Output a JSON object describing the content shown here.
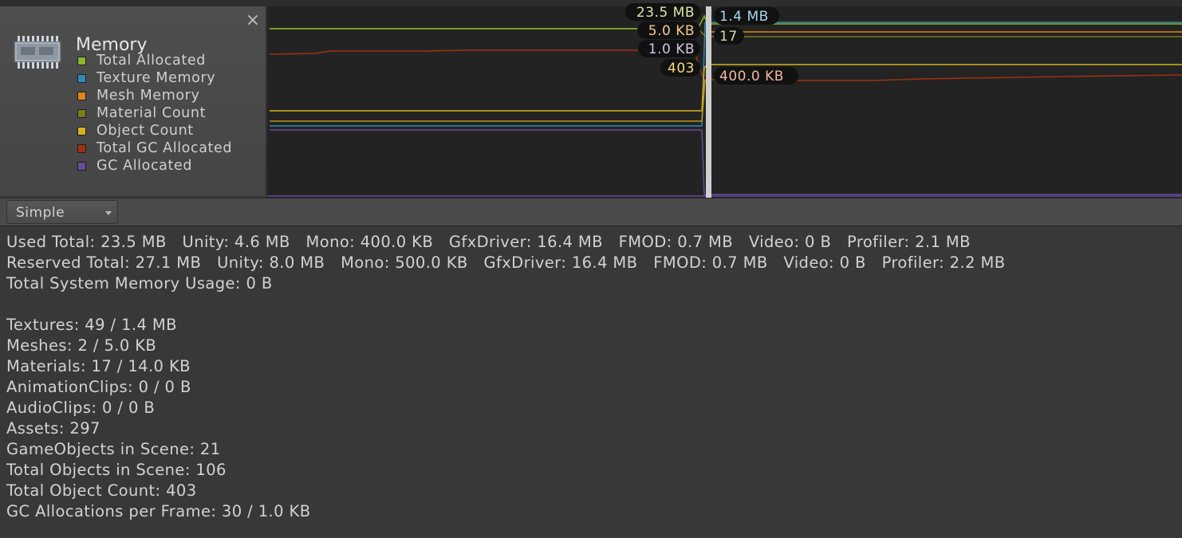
{
  "module": {
    "title": "Memory",
    "close_glyph": "×",
    "icon": "memory-chip-icon",
    "legend": [
      {
        "label": "Total Allocated",
        "color": "#8db32b"
      },
      {
        "label": "Texture Memory",
        "color": "#2f8db5"
      },
      {
        "label": "Mesh Memory",
        "color": "#e0841c"
      },
      {
        "label": "Material Count",
        "color": "#7a7a1a"
      },
      {
        "label": "Object Count",
        "color": "#d6b31d"
      },
      {
        "label": "Total GC Allocated",
        "color": "#a0300e"
      },
      {
        "label": "GC Allocated",
        "color": "#6a4a9a"
      }
    ]
  },
  "graph": {
    "tooltips": {
      "total_allocated": "23.5 MB",
      "mesh_memory": "5.0 KB",
      "gc_allocated": "1.0 KB",
      "object_count": "403",
      "texture_memory": "1.4 MB",
      "material_count": "17",
      "total_gc_allocated": "400.0 KB"
    }
  },
  "toolbar": {
    "view_mode": "Simple"
  },
  "stats": {
    "lines": [
      "Used Total: 23.5 MB   Unity: 4.6 MB   Mono: 400.0 KB   GfxDriver: 16.4 MB   FMOD: 0.7 MB   Video: 0 B   Profiler: 2.1 MB",
      "Reserved Total: 27.1 MB   Unity: 8.0 MB   Mono: 500.0 KB   GfxDriver: 16.4 MB   FMOD: 0.7 MB   Video: 0 B   Profiler: 2.2 MB",
      "Total System Memory Usage: 0 B"
    ],
    "assets": [
      "Textures: 49 / 1.4 MB",
      "Meshes: 2 / 5.0 KB",
      "Materials: 17 / 14.0 KB",
      "AnimationClips: 0 / 0 B",
      "AudioClips: 0 / 0 B",
      "Assets: 297",
      "GameObjects in Scene: 21",
      "Total Objects in Scene: 106",
      "Total Object Count: 403",
      "GC Allocations per Frame: 30 / 1.0 KB"
    ]
  }
}
